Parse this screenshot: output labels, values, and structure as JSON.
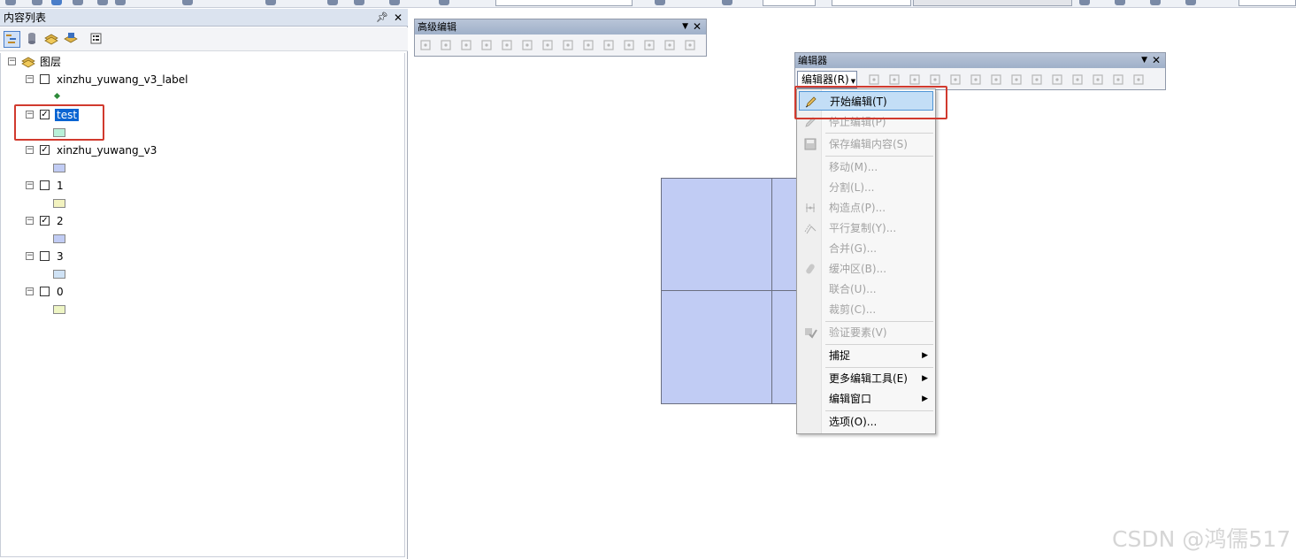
{
  "toc": {
    "title": "内容列表",
    "root_label": "图层",
    "layers": [
      {
        "name": "xinzhu_yuwang_v3_label",
        "checked": false,
        "swatch": "point",
        "color": "#2e8b3a"
      },
      {
        "name": "test",
        "checked": true,
        "swatch": "poly",
        "color": "#b8f0d9",
        "selected": true
      },
      {
        "name": "xinzhu_yuwang_v3",
        "checked": true,
        "swatch": "poly",
        "color": "#c1ccf4"
      },
      {
        "name": "1",
        "checked": false,
        "swatch": "poly",
        "color": "#f2f2bf"
      },
      {
        "name": "2",
        "checked": true,
        "swatch": "poly",
        "color": "#c1ccf4"
      },
      {
        "name": "3",
        "checked": false,
        "swatch": "poly",
        "color": "#cfe2f5"
      },
      {
        "name": "0",
        "checked": false,
        "swatch": "poly",
        "color": "#eef5c4"
      }
    ]
  },
  "advanced_toolbar": {
    "title": "高级编辑"
  },
  "editor_toolbar": {
    "title": "编辑器",
    "menu_button": "编辑器(R)"
  },
  "editor_menu": {
    "items": [
      {
        "label": "开始编辑(T)",
        "enabled": true,
        "highlighted": true,
        "icon": "pencil-icon"
      },
      {
        "label": "停止编辑(P)",
        "enabled": false,
        "icon": "stop-edit-icon"
      },
      {
        "label": "保存编辑内容(S)",
        "enabled": false,
        "icon": "save-icon"
      },
      {
        "label": "移动(M)...",
        "enabled": false
      },
      {
        "label": "分割(L)...",
        "enabled": false
      },
      {
        "label": "构造点(P)...",
        "enabled": false,
        "icon": "construct-points-icon"
      },
      {
        "label": "平行复制(Y)...",
        "enabled": false,
        "icon": "copy-parallel-icon"
      },
      {
        "label": "合并(G)...",
        "enabled": false
      },
      {
        "label": "缓冲区(B)...",
        "enabled": false,
        "icon": "buffer-icon"
      },
      {
        "label": "联合(U)...",
        "enabled": false
      },
      {
        "label": "裁剪(C)...",
        "enabled": false
      },
      {
        "label": "验证要素(V)",
        "enabled": false,
        "icon": "validate-icon"
      },
      {
        "label": "捕捉",
        "enabled": true,
        "submenu": true
      },
      {
        "label": "更多编辑工具(E)",
        "enabled": true,
        "submenu": true
      },
      {
        "label": "编辑窗口",
        "enabled": true,
        "submenu": true
      },
      {
        "label": "选项(O)...",
        "enabled": true
      }
    ]
  },
  "watermark": "CSDN @鸿儒517",
  "colors": {
    "selection": "#0a64d2",
    "highlight_box": "#d13a2e",
    "polygon_fill": "#c1ccf4"
  }
}
